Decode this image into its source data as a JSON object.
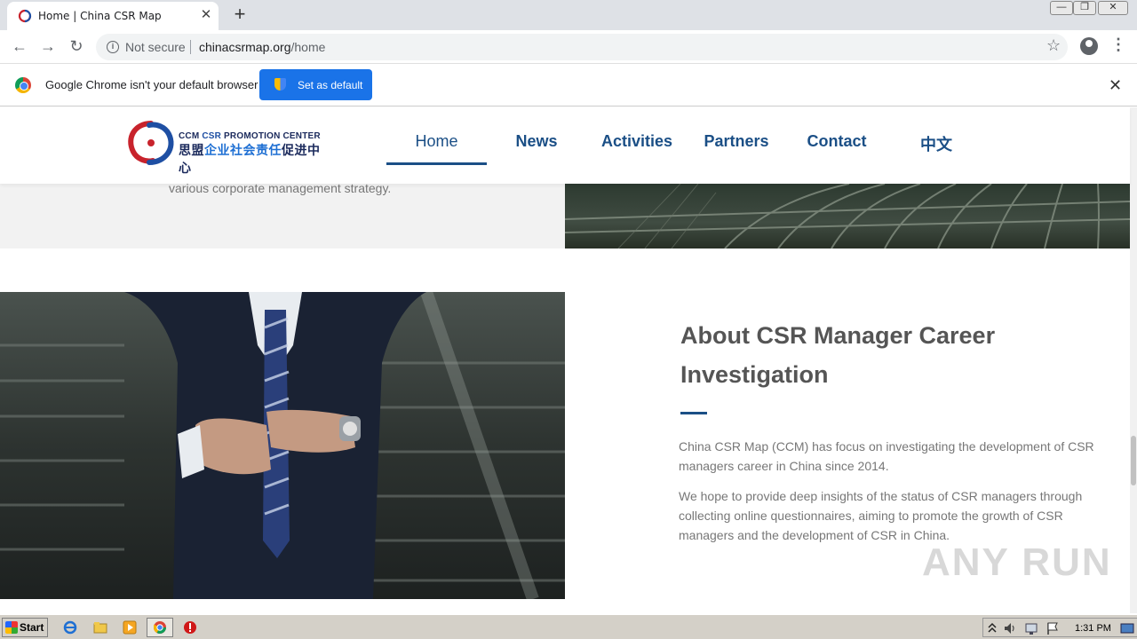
{
  "browser": {
    "tab_title": "Home | China CSR Map",
    "tab_close": "✕",
    "new_tab": "+",
    "win_controls": [
      "—",
      "❐",
      "✕"
    ],
    "back": "←",
    "forward": "→",
    "reload": "↻",
    "security_label": "Not secure",
    "url_host": "chinacsrmap.org",
    "url_path": "/home",
    "star": "☆",
    "menu": "⋮"
  },
  "infobar": {
    "message": "Google Chrome isn't your default browser",
    "button_label": "Set as default",
    "close": "✕"
  },
  "site": {
    "logo_en_prefix": "CCM ",
    "logo_en_csr": "CSR",
    "logo_en_rest": " PROMOTION CENTER",
    "logo_cn_left": "思盟",
    "logo_cn_blue": "企业社会责任",
    "logo_cn_right": "促进中心",
    "nav": [
      "Home",
      "News",
      "Activities",
      "Partners",
      "Contact",
      "中文"
    ],
    "active_nav": "Home",
    "band_text": "various corporate management strategy.",
    "about_title": "About CSR Manager Career Investigation",
    "about_p1": "China CSR Map (CCM) has focus on investigating the development of CSR managers career in China since 2014.",
    "about_p2": "We hope  to provide deep insights of the status of CSR managers through collecting online questionnaires, aiming to promote the growth of CSR managers and the development of CSR in China.",
    "watermark": "ANY RUN"
  },
  "taskbar": {
    "start_label": "Start",
    "clock": "1:31 PM"
  },
  "colors": {
    "nav_blue": "#1b4f86",
    "chrome_blue": "#1a73e8",
    "taskbar": "#d4d0c8"
  }
}
